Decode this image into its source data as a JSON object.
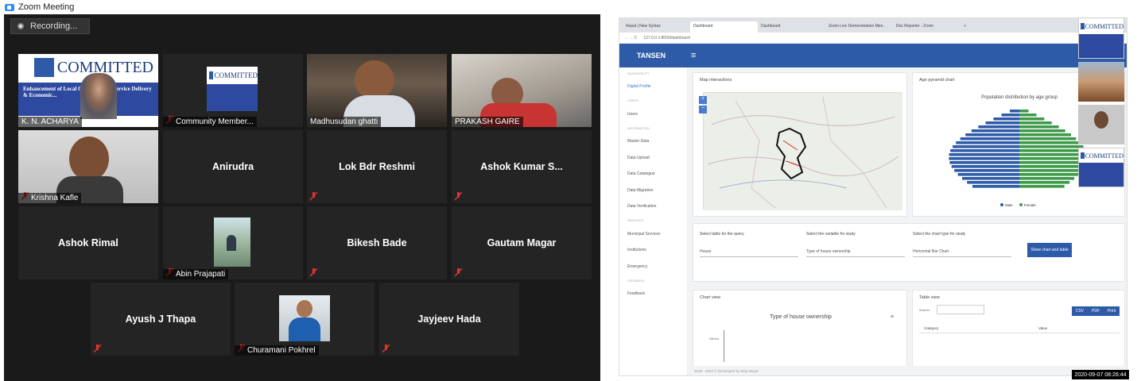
{
  "window": {
    "title": "Zoom Meeting"
  },
  "recording": {
    "label": "Recording..."
  },
  "participants": [
    {
      "name": "K. N. ACHARYA",
      "type": "video"
    },
    {
      "name": "Community Member...",
      "type": "video-muted"
    },
    {
      "name": "Madhusudan ghatti",
      "type": "video-active"
    },
    {
      "name": "PRAKASH GAIRE",
      "type": "video"
    },
    {
      "name": "Krishna Kafle",
      "type": "video-muted"
    },
    {
      "name": "Anirudra",
      "type": "name-only"
    },
    {
      "name": "Lok Bdr Reshmi",
      "type": "name-only"
    },
    {
      "name": "Ashok Kumar S...",
      "type": "name-only"
    },
    {
      "name": "Ashok Rimal",
      "type": "name-only"
    },
    {
      "name": "Abin Prajapati",
      "type": "photo-muted"
    },
    {
      "name": "Bikesh Bade",
      "type": "name-only"
    },
    {
      "name": "Gautam  Magar",
      "type": "name-only"
    },
    {
      "name": "Ayush J Thapa",
      "type": "name-only"
    },
    {
      "name": "Churamani Pokhrel",
      "type": "photo-muted"
    },
    {
      "name": "Jayjeev Hada",
      "type": "name-only"
    }
  ],
  "committed_logo": {
    "text": "COMMITTED",
    "sub": "Enhancement of Local Governments, Service Delivery & Economic..."
  },
  "browser": {
    "tabs": [
      "Nepal | New Syntax",
      "Dashboard",
      "Dashboard",
      "Zoom Live Demonstration Mee...",
      "Doc Reporter - Zoom",
      "+"
    ],
    "url": "127.0.0.1:8000/dashboard",
    "app_title": "TANSEN",
    "sidebar": [
      {
        "label": "MUNICIPALITY",
        "head": true
      },
      {
        "label": "Digital Profile",
        "sel": true
      },
      {
        "label": "USERS",
        "head": true
      },
      {
        "label": "Users"
      },
      {
        "label": "INFORMATION",
        "head": true
      },
      {
        "label": "Master Data"
      },
      {
        "label": "Data Upload"
      },
      {
        "label": "Data Catalogue"
      },
      {
        "label": "Data Migration"
      },
      {
        "label": "Data Verification"
      },
      {
        "label": "SERVICES",
        "head": true
      },
      {
        "label": "Municipal Services"
      },
      {
        "label": "Institutions"
      },
      {
        "label": "Emergency"
      },
      {
        "label": "FEEDBACK",
        "head": true
      },
      {
        "label": "Feedback"
      }
    ],
    "map_title": "Map interactions",
    "age_title": "Age pyramid chart",
    "age_chart_title": "Population distribution by age group",
    "legend_male": "Male",
    "legend_female": "Female",
    "query": {
      "table_label": "Select table for the query",
      "variable_label": "Select the variable for study",
      "chart_label": "Select the chart type for study",
      "table_value": "House",
      "variable_value": "Type of house ownership",
      "chart_value": "Horizontal Bar Chart",
      "button": "Show chart and table"
    },
    "chart_view": {
      "title": "Chart view",
      "chart_title": "Type of house ownership",
      "row": "Others"
    },
    "table_view": {
      "title": "Table view",
      "search": "Search:",
      "col1": "Category",
      "col2": "Value",
      "csv": "CSV",
      "pdf": "PDF",
      "print": "Print"
    },
    "footer": "2018 - 2022 © Developed by Map Nepal"
  },
  "timestamp": "2020-09-07 08:26:44"
}
